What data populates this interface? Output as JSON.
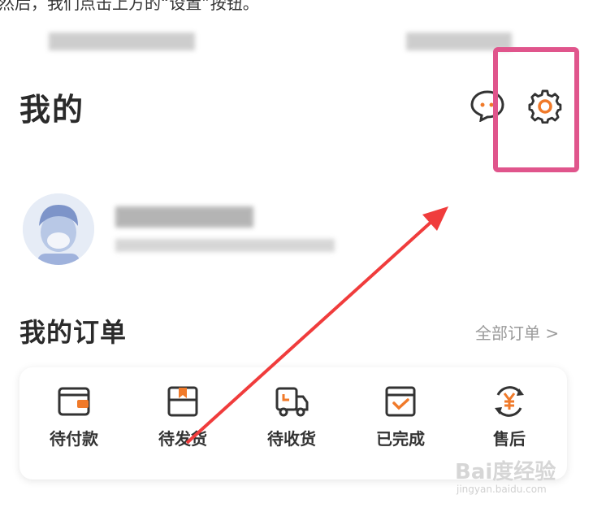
{
  "caption": "然后，我们点击上方的“设置”按钮。",
  "page_title": "我的",
  "orders": {
    "title": "我的订单",
    "all_link": "全部订单 >",
    "items": [
      {
        "label": "待付款",
        "icon": "wallet-icon"
      },
      {
        "label": "待发货",
        "icon": "box-icon"
      },
      {
        "label": "待收货",
        "icon": "truck-icon"
      },
      {
        "label": "已完成",
        "icon": "calendar-check-icon"
      },
      {
        "label": "售后",
        "icon": "refund-yuan-icon"
      }
    ]
  },
  "header_icons": [
    "chat-icon",
    "gear-icon"
  ],
  "colors": {
    "accent": "#f07a2a",
    "highlight": "#e0558c",
    "arrow": "#f03c3c"
  },
  "watermark": {
    "text": "Bai度经验",
    "sub": "jingyan.baidu.com"
  }
}
